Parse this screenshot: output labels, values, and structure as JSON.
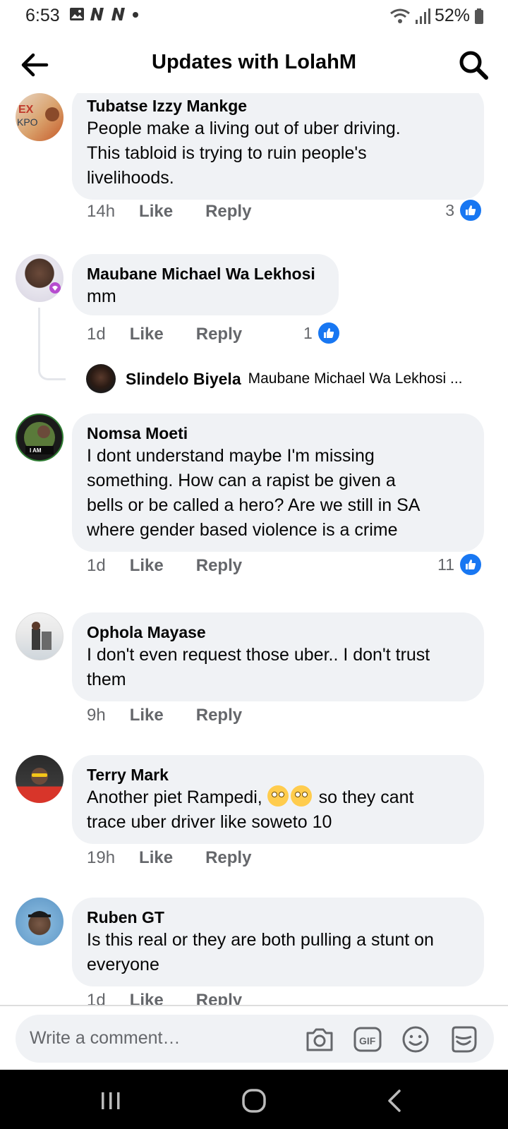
{
  "status_bar": {
    "time": "6:53",
    "battery": "52%"
  },
  "header": {
    "title": "Updates with LolahM"
  },
  "comments": [
    {
      "name": "Tubatse Izzy Mankge",
      "lines": [
        "People make a living out of uber driving.",
        "This tabloid is trying to ruin people's",
        "livelihoods."
      ],
      "time": "14h",
      "like": "Like",
      "reply": "Reply",
      "reactions": "3"
    },
    {
      "name": "Maubane Michael Wa Lekhosi",
      "lines": [
        "mm"
      ],
      "time": "1d",
      "like": "Like",
      "reply": "Reply",
      "reactions": "1",
      "reply_preview": {
        "name": "Slindelo Biyela",
        "text": "Maubane Michael Wa Lekhosi ..."
      }
    },
    {
      "name": "Nomsa Moeti",
      "lines": [
        "I dont understand maybe I'm missing",
        "something.  How can a rapist be given a",
        "bells or be called a hero? Are we still in SA",
        "where gender based violence is a crime"
      ],
      "time": "1d",
      "like": "Like",
      "reply": "Reply",
      "reactions": "11"
    },
    {
      "name": "Ophola Mayase",
      "lines": [
        "I don't even request those uber.. I don't trust",
        "them"
      ],
      "time": "9h",
      "like": "Like",
      "reply": "Reply"
    },
    {
      "name": "Terry Mark",
      "lines": [
        "Another piet Rampedi,",
        "trace uber driver like soweto 10"
      ],
      "line1_suffix": "so they cant",
      "time": "19h",
      "like": "Like",
      "reply": "Reply"
    },
    {
      "name": "Ruben GT",
      "lines": [
        "Is this real or they are both pulling a stunt on",
        "everyone"
      ],
      "time": "1d",
      "like": "Like",
      "reply": "Reply"
    }
  ],
  "composer": {
    "placeholder": "Write a comment…"
  },
  "icons": {
    "back": "arrow-left-icon",
    "search": "search-icon",
    "camera": "camera-icon",
    "gif": "gif-icon",
    "emoji": "emoji-icon",
    "sticker": "sticker-icon",
    "like_badge": "thumbs-up-icon",
    "eyeroll": "eye-roll-emoji"
  },
  "colors": {
    "bubble": "#f0f2f5",
    "like_blue": "#1877f2",
    "meta_gray": "#65676b"
  }
}
